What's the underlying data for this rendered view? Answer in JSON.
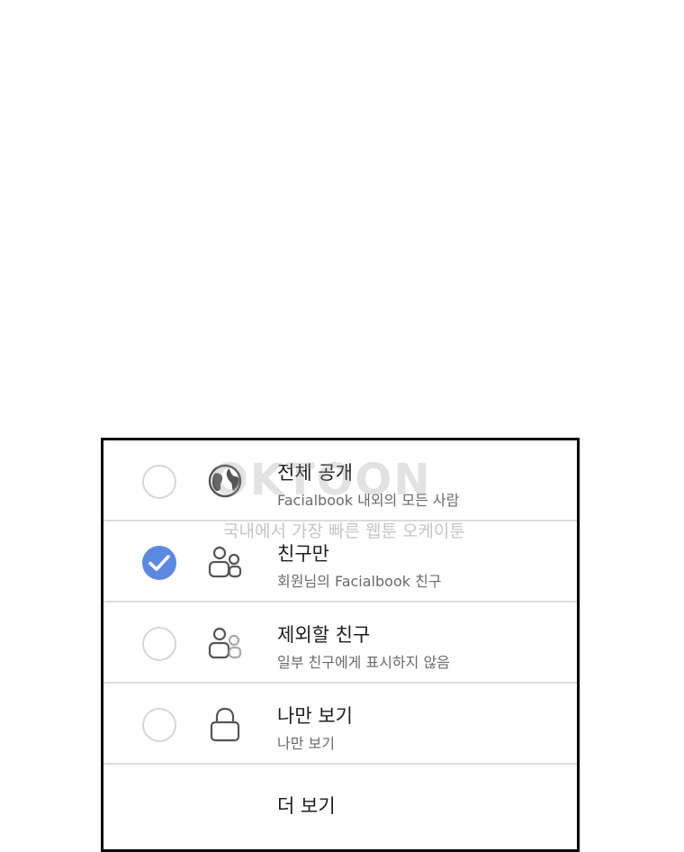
{
  "options": [
    {
      "title": "전체 공개",
      "subtitle": "Facialbook 내외의 모든 사람",
      "icon": "globe-icon",
      "selected": false
    },
    {
      "title": "친구만",
      "subtitle": "회원님의 Facialbook 친구",
      "icon": "friends-icon",
      "selected": true
    },
    {
      "title": "제외할 친구",
      "subtitle": "일부 친구에게 표시하지 않음",
      "icon": "friends-except-icon",
      "selected": false
    },
    {
      "title": "나만 보기",
      "subtitle": "나만 보기",
      "icon": "lock-icon",
      "selected": false
    }
  ],
  "more": {
    "label": "더 보기"
  },
  "watermark": {
    "logo": "OKTOON",
    "tagline": "국내에서 가장 빠른 웹툰 오케이툰"
  },
  "colors": {
    "accent": "#5b88e0",
    "divider": "#dcdcdc",
    "border": "#000000"
  }
}
